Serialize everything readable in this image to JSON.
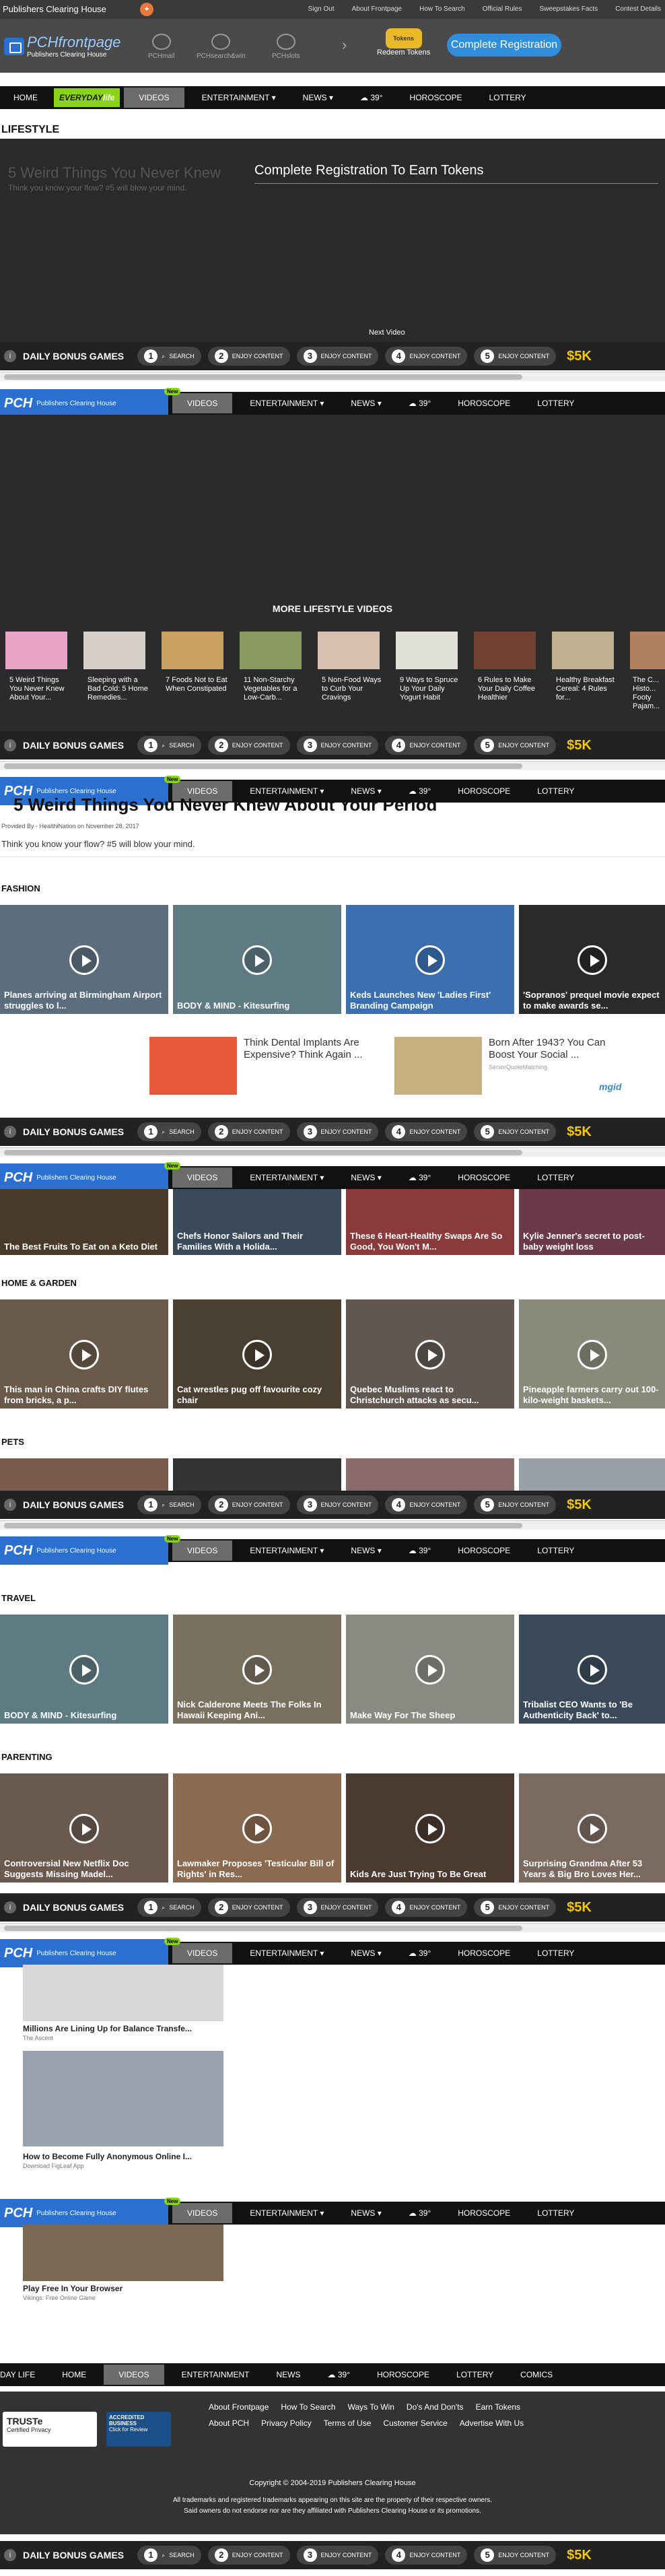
{
  "topbar": {
    "brand": "Publishers Clearing House",
    "links": [
      "Sign Out",
      "About Frontpage",
      "How To Search",
      "Official Rules",
      "Sweepstakes Facts",
      "Contest Details"
    ]
  },
  "header": {
    "logo_main": "PCH",
    "logo_accent": "frontpage",
    "logo_sub": "Publishers Clearing House",
    "icons": [
      "PCHmail",
      "PCHsearch&win",
      "PCHslots"
    ],
    "tokens_badge": "Tokens",
    "tokens_label": "Redeem Tokens",
    "register": "Complete Registration"
  },
  "nav": {
    "everyday": "EVERYDAY",
    "life": "life",
    "items": [
      "HOME",
      "VIDEOS",
      "ENTERTAINMENT ▾",
      "NEWS ▾",
      "39°",
      "HOROSCOPE",
      "LOTTERY"
    ],
    "new_badge": "New"
  },
  "hero": {
    "section": "LIFESTYLE",
    "title": "5 Weird Things You Never Knew",
    "overlay": "Complete Registration To Earn Tokens",
    "subtitle": "Think you know your flow? #5 will blow your mind.",
    "next": "Next Video"
  },
  "bonus": {
    "title": "DAILY BONUS GAMES",
    "slots": [
      {
        "n": "1",
        "l": "SEARCH"
      },
      {
        "n": "2",
        "l": "ENJOY CONTENT"
      },
      {
        "n": "3",
        "l": "ENJOY CONTENT"
      },
      {
        "n": "4",
        "l": "ENJOY CONTENT"
      },
      {
        "n": "5",
        "l": "ENJOY CONTENT"
      }
    ],
    "prize": "$5K"
  },
  "more": {
    "title": "MORE LIFESTYLE VIDEOS",
    "items": [
      "5 Weird Things You Never Knew About Your...",
      "Sleeping with a Bad Cold: 5 Home Remedies...",
      "7 Foods Not to Eat When Constipated",
      "11 Non-Starchy Vegetables for a Low-Carb...",
      "5 Non-Food Ways to Curb Your Cravings",
      "9 Ways to Spruce Up Your Daily Yogurt Habit",
      "6 Rules to Make Your Daily Coffee Healthier",
      "Healthy Breakfast Cereal: 4 Rules for...",
      "The C... Histo... Footy Pajam..."
    ]
  },
  "article": {
    "title": "5 Weird Things You Never Knew About Your Period",
    "meta": "Provided By - HealthiNation on November 28, 2017",
    "body": "Think you know your flow? #5 will blow your mind."
  },
  "fashion": {
    "title": "FASHION",
    "cards": [
      "Planes arriving at Birmingham Airport struggles to l...",
      "BODY & MIND - Kitesurfing",
      "Keds Launches New 'Ladies First' Branding Campaign",
      "'Sopranos' prequel movie expect to make awards se..."
    ]
  },
  "ads": [
    {
      "text": "Think Dental Implants Are Expensive? Think Again ..."
    },
    {
      "text": "Born After 1943? You Can Boost Your Social ...",
      "src": "SeniorQuoteMatching"
    }
  ],
  "adlogo": "mgid",
  "food": {
    "cards": [
      "The Best Fruits To Eat on a Keto Diet",
      "Chefs Honor Sailors and Their Families With a Holida...",
      "These 6 Heart-Healthy Swaps Are So Good, You Won't M...",
      "Kylie Jenner's secret to post-baby weight loss"
    ]
  },
  "home": {
    "title": "HOME & GARDEN",
    "cards": [
      "This man in China crafts DIY flutes from bricks, a p...",
      "Cat wrestles pug off favourite cozy chair",
      "Quebec Muslims react to Christchurch attacks as secu...",
      "Pineapple farmers carry out 100-kilo-weight baskets..."
    ]
  },
  "pets": {
    "title": "PETS"
  },
  "travel": {
    "title": "TRAVEL",
    "cards": [
      "BODY & MIND - Kitesurfing",
      "Nick Calderone Meets The Folks In Hawaii Keeping Ani...",
      "Make Way For The Sheep",
      "Tribalist CEO Wants to 'Be Authenticity Back' to..."
    ]
  },
  "parenting": {
    "title": "PARENTING",
    "cards": [
      "Controversial New Netflix Doc Suggests Missing Madel...",
      "Lawmaker Proposes 'Testicular Bill of Rights' in Res...",
      "Kids Are Just Trying To Be Great",
      "Surprising Grandma After 53 Years & Big Bro Loves Her..."
    ]
  },
  "sponsored": [
    {
      "title": "Millions Are Lining Up for Balance Transfe...",
      "src": "The Ascent"
    },
    {
      "title": "How to Become Fully Anonymous Online I...",
      "src": "Download FigLeaf App"
    },
    {
      "title": "Play Free In Your Browser",
      "src": "Vikings: Free Online Game"
    }
  ],
  "bottomnav": [
    "DAY LIFE",
    "HOME",
    "VIDEOS",
    "ENTERTAINMENT",
    "NEWS",
    "39°",
    "HOROSCOPE",
    "LOTTERY",
    "COMICS"
  ],
  "footer": {
    "row1": [
      "About Frontpage",
      "How To Search",
      "Ways To Win",
      "Do's And Don'ts",
      "Earn Tokens"
    ],
    "row2": [
      "About PCH",
      "Privacy Policy",
      "Terms of Use",
      "Customer Service",
      "Advertise With Us"
    ],
    "truste": "TRUSTe",
    "truste_sub": "Certified Privacy",
    "bbb": "ACCREDITED BUSINESS",
    "bbb_sub": "Click for Review",
    "copyright": "Copyright © 2004-2019 Publishers Clearing House",
    "disclaimer1": "All trademarks and registered trademarks appearing on this site are the property of their respective owners.",
    "disclaimer2": "Said owners do not endorse nor are they affiliated with Publishers Clearing House or its promotions."
  }
}
